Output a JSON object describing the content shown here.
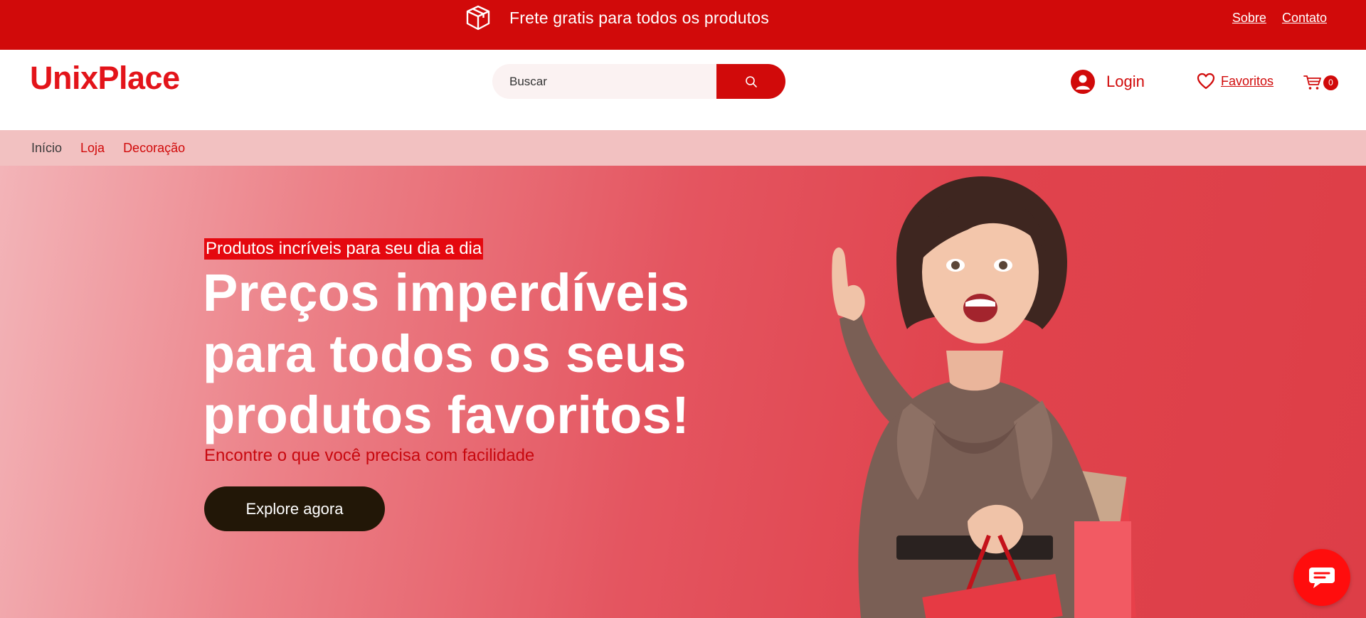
{
  "topbar": {
    "promo_text": "Frete gratis para todos os produtos",
    "links": [
      "Sobre",
      "Contato"
    ],
    "promo_icon": "box-icon"
  },
  "header": {
    "logo": "UnixPlace",
    "search": {
      "placeholder": "Buscar",
      "button_icon": "search-icon"
    },
    "login_label": "Login",
    "favorites_label": "Favoritos",
    "cart_count": "0"
  },
  "nav": {
    "items": [
      "Início",
      "Loja",
      "Decoração"
    ]
  },
  "hero": {
    "kicker": "Produtos incríveis para seu dia a dia",
    "headline": "Preços imperdíveis para todos os seus produtos favoritos!",
    "subline": "Encontre o que você precisa com facilidade",
    "cta": "Explore agora"
  },
  "colors": {
    "brand_red": "#d10a0a",
    "logo_red": "#e3141a",
    "nav_bg": "#f2c1c1",
    "cta_bg": "#221707",
    "chat_bg": "#ff0d0d"
  }
}
